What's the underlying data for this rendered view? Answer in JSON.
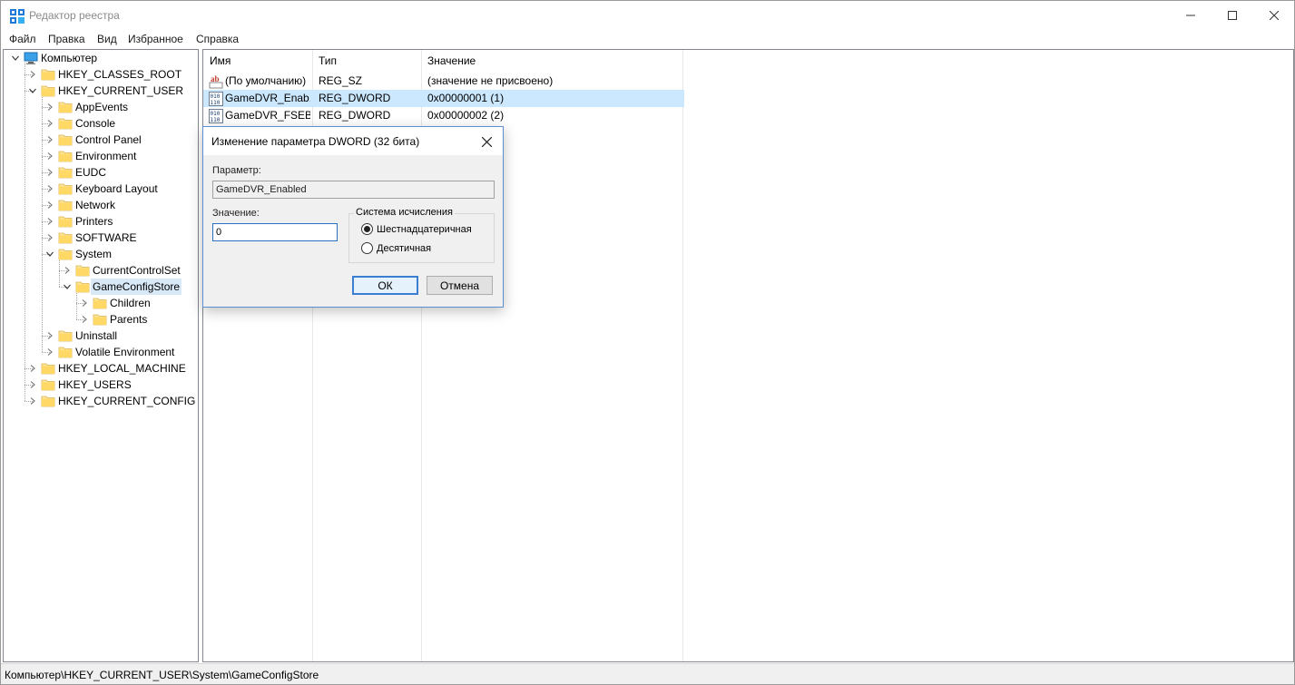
{
  "window": {
    "title": "Редактор реестра",
    "menu": [
      "Файл",
      "Правка",
      "Вид",
      "Избранное",
      "Справка"
    ]
  },
  "tree": {
    "nodes": [
      {
        "label": "Компьютер",
        "level": 0,
        "expanded": true,
        "icon": "computer-icon"
      },
      {
        "label": "HKEY_CLASSES_ROOT",
        "level": 1,
        "expanded": false
      },
      {
        "label": "HKEY_CURRENT_USER",
        "level": 1,
        "expanded": true
      },
      {
        "label": "AppEvents",
        "level": 2,
        "expanded": false
      },
      {
        "label": "Console",
        "level": 2,
        "expanded": false
      },
      {
        "label": "Control Panel",
        "level": 2,
        "expanded": false
      },
      {
        "label": "Environment",
        "level": 2,
        "expanded": false
      },
      {
        "label": "EUDC",
        "level": 2,
        "expanded": false
      },
      {
        "label": "Keyboard Layout",
        "level": 2,
        "expanded": false
      },
      {
        "label": "Network",
        "level": 2,
        "expanded": false
      },
      {
        "label": "Printers",
        "level": 2,
        "expanded": false
      },
      {
        "label": "SOFTWARE",
        "level": 2,
        "expanded": false
      },
      {
        "label": "System",
        "level": 2,
        "expanded": true
      },
      {
        "label": "CurrentControlSet",
        "level": 3,
        "expanded": false
      },
      {
        "label": "GameConfigStore",
        "level": 3,
        "expanded": true,
        "selected": true
      },
      {
        "label": "Children",
        "level": 4,
        "expanded": false
      },
      {
        "label": "Parents",
        "level": 4,
        "expanded": false
      },
      {
        "label": "Uninstall",
        "level": 2,
        "expanded": false
      },
      {
        "label": "Volatile Environment",
        "level": 2,
        "expanded": false
      },
      {
        "label": "HKEY_LOCAL_MACHINE",
        "level": 1,
        "expanded": false
      },
      {
        "label": "HKEY_USERS",
        "level": 1,
        "expanded": false
      },
      {
        "label": "HKEY_CURRENT_CONFIG",
        "level": 1,
        "expanded": false
      }
    ]
  },
  "list": {
    "columns": [
      "Имя",
      "Тип",
      "Значение"
    ],
    "rows": [
      {
        "name": "(По умолчанию)",
        "type": "REG_SZ",
        "value": "(значение не присвоено)",
        "icon": "string-value-icon"
      },
      {
        "name": "GameDVR_Enab...",
        "type": "REG_DWORD",
        "value": "0x00000001 (1)",
        "icon": "binary-value-icon",
        "selected": true
      },
      {
        "name": "GameDVR_FSEB...",
        "type": "REG_DWORD",
        "value": "0x00000002 (2)",
        "icon": "binary-value-icon"
      }
    ]
  },
  "status": {
    "path": "Компьютер\\HKEY_CURRENT_USER\\System\\GameConfigStore"
  },
  "dialog": {
    "title": "Изменение параметра DWORD (32 бита)",
    "param_label": "Параметр:",
    "param_value": "GameDVR_Enabled",
    "value_label": "Значение:",
    "value_input": "0",
    "base_group_title": "Система исчисления",
    "radio_hex": "Шестнадцатеричная",
    "radio_dec": "Десятичная",
    "selected_base": "hex",
    "ok_label": "ОК",
    "cancel_label": "Отмена"
  }
}
